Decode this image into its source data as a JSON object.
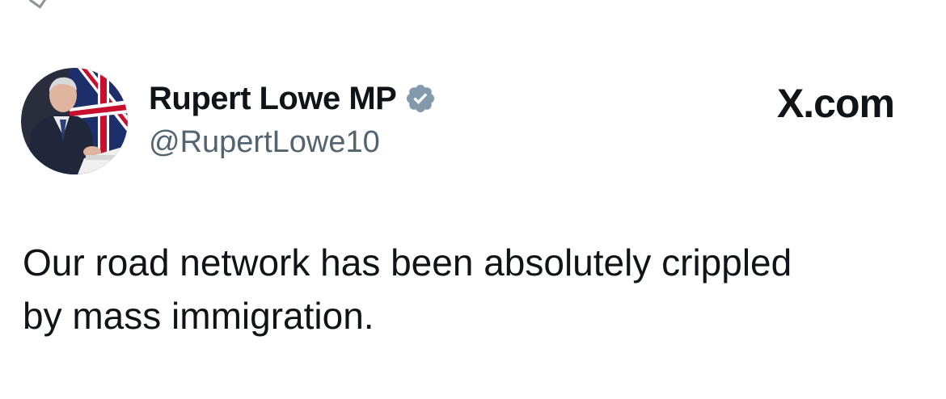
{
  "author": {
    "display_name": "Rupert Lowe MP",
    "handle": "@RupertLowe10",
    "verified": true,
    "avatar_description": "man at podium with flag background"
  },
  "brand": {
    "label": "X.com"
  },
  "tweet": {
    "line1": "Our road network has been absolutely crippled",
    "line2": "by mass immigration."
  },
  "colors": {
    "text_primary": "#0f1419",
    "text_secondary": "#536471",
    "verified_badge": "#829aab",
    "background": "#ffffff"
  },
  "icons": {
    "verified": "verified-badge-icon",
    "avatar": "avatar-photo"
  }
}
